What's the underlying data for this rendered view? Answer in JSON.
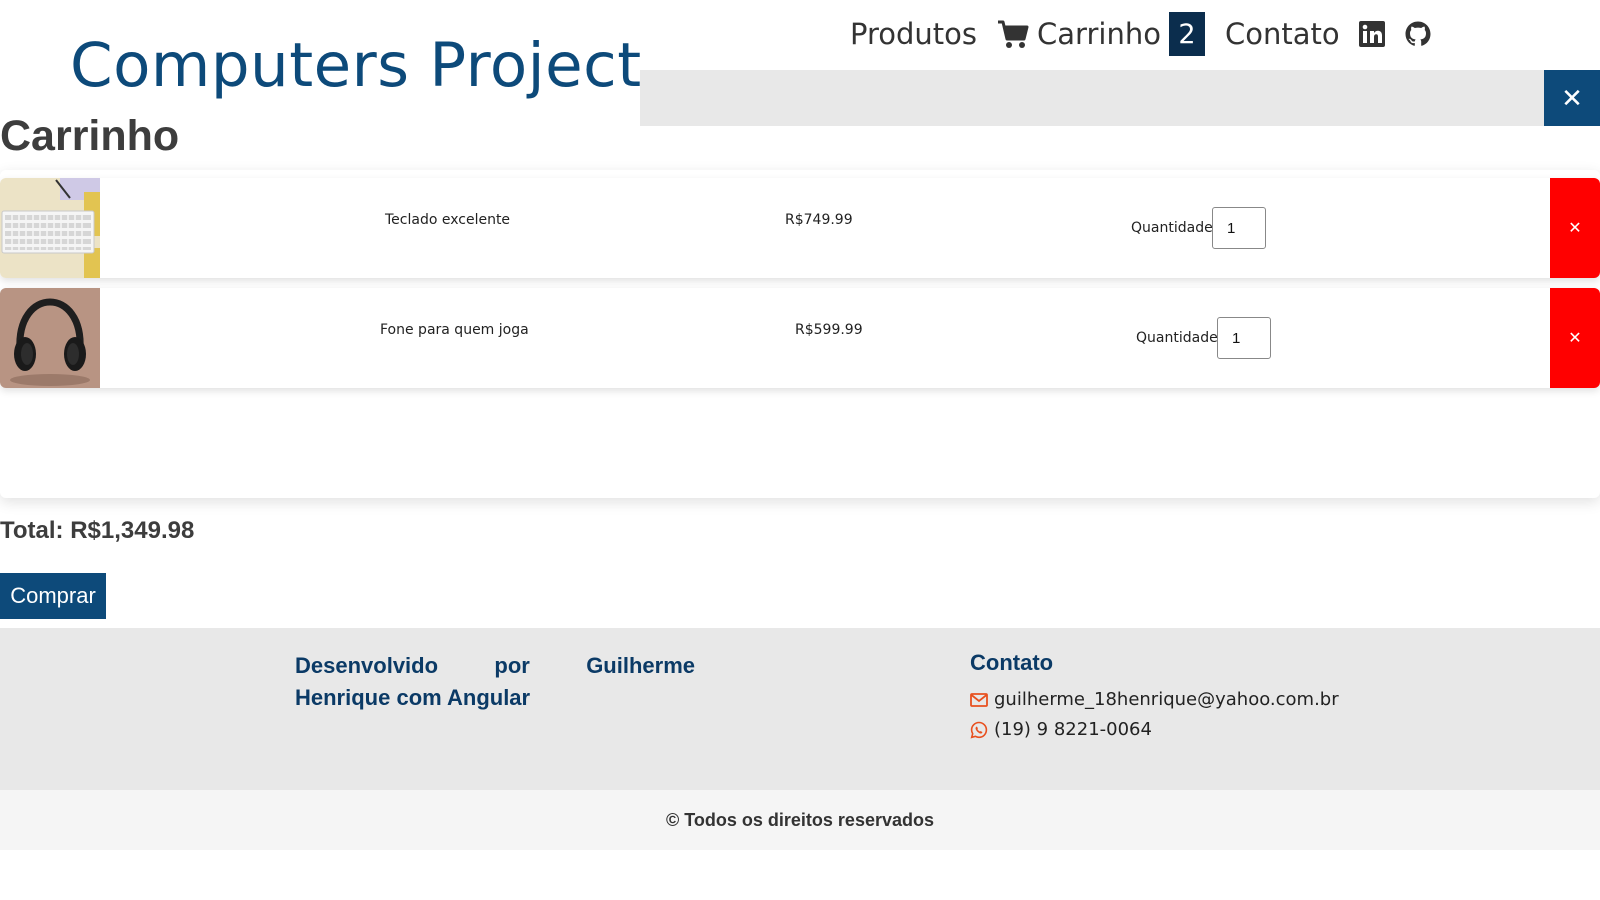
{
  "header": {
    "brand": "Computers Project",
    "nav": {
      "produtos": "Produtos",
      "carrinho": "Carrinho",
      "cart_count": "2",
      "contato": "Contato"
    },
    "icons": [
      "cart-icon",
      "linkedin-icon",
      "github-icon"
    ],
    "close_search": "✕"
  },
  "cart": {
    "title": "Carrinho",
    "items": [
      {
        "name": "Teclado excelente",
        "price": "R$749.99",
        "qty_label": "Quantidade:",
        "qty": "1",
        "remove": "✕",
        "thumb": "keyboard"
      },
      {
        "name": "Fone para quem joga",
        "price": "R$599.99",
        "qty_label": "Quantidade:",
        "qty": "1",
        "remove": "✕",
        "thumb": "headphones"
      }
    ],
    "total": "Total: R$1,349.98",
    "buy": "Comprar"
  },
  "footer": {
    "developer": "Desenvolvido por Guilherme Henrique com Angular",
    "contact_title": "Contato",
    "email": "guilherme_18henrique@yahoo.com.br",
    "phone": "(19) 9 8221-0064",
    "copyright": "© Todos os direitos reservados"
  },
  "colors": {
    "brand": "#0d4a7a",
    "badge": "#0b2d4d",
    "remove": "#ff0000",
    "footer_bg": "#e8e8e8",
    "footer_heading": "#0b3a66",
    "contact_icon": "#e8501f"
  }
}
